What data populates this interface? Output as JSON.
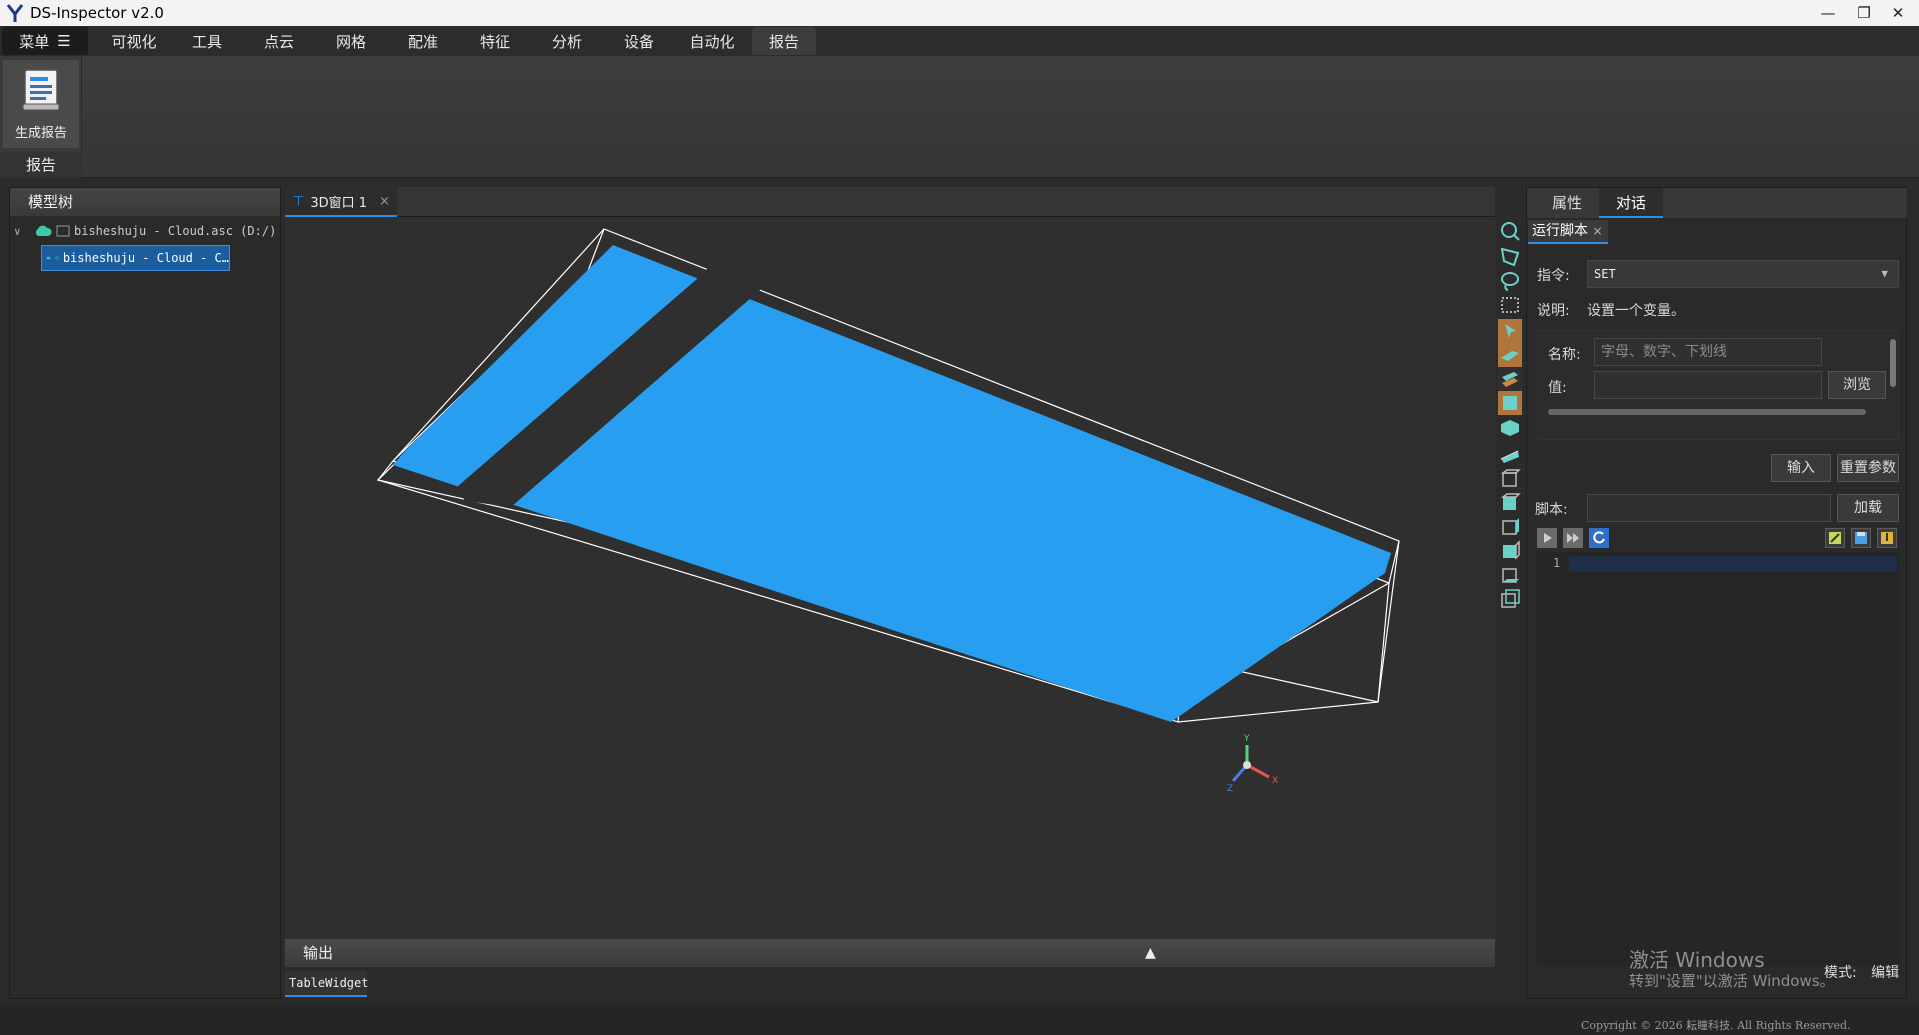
{
  "app": {
    "title": "DS-Inspector v2.0"
  },
  "menubar": {
    "menu_label": "菜单",
    "tabs": [
      "可视化",
      "工具",
      "点云",
      "网格",
      "配准",
      "特征",
      "分析",
      "设备",
      "自动化",
      "报告"
    ],
    "active_tab": "报告"
  },
  "ribbon": {
    "generate_report_label": "生成报告",
    "group_label": "报告"
  },
  "model_tree": {
    "title": "模型树",
    "items": [
      {
        "label": "bisheshuju - Cloud.asc (D:/)"
      },
      {
        "label": "bisheshuju - Cloud - C…"
      }
    ]
  },
  "viewport": {
    "tab_label": "3D窗口 1",
    "tab_close": "×",
    "axis_labels": {
      "x": "X",
      "y": "Y",
      "z": "Z"
    }
  },
  "output": {
    "title": "输出",
    "toggle_icon": "▲",
    "tab_label": "TableWidget"
  },
  "right_panel": {
    "tabs": [
      "属性",
      "对话"
    ],
    "active_tab": "对话",
    "subtab_label": "运行脚本",
    "subtab_close": "×",
    "command_label": "指令:",
    "command_value": "SET",
    "desc_label": "说明:",
    "desc_text": "设置一个变量。",
    "name_label": "名称:",
    "name_placeholder": "字母、数字、下划线",
    "value_label": "值:",
    "browse_label": "浏览",
    "input_label": "输入",
    "reset_label": "重置参数",
    "script_label": "脚本:",
    "load_label": "加载",
    "line_number": "1"
  },
  "watermark": {
    "line1": "激活 Windows",
    "line2": "转到\"设置\"以激活 Windows。"
  },
  "mode": {
    "label": "模式:",
    "value": "编辑"
  },
  "footer": {
    "copyright": "Copyright © 2026 耘瞳科技. All Rights Reserved."
  },
  "colors": {
    "accent": "#2d8ee6",
    "cloud": "#279ef0",
    "background": "#2f2f2f"
  }
}
